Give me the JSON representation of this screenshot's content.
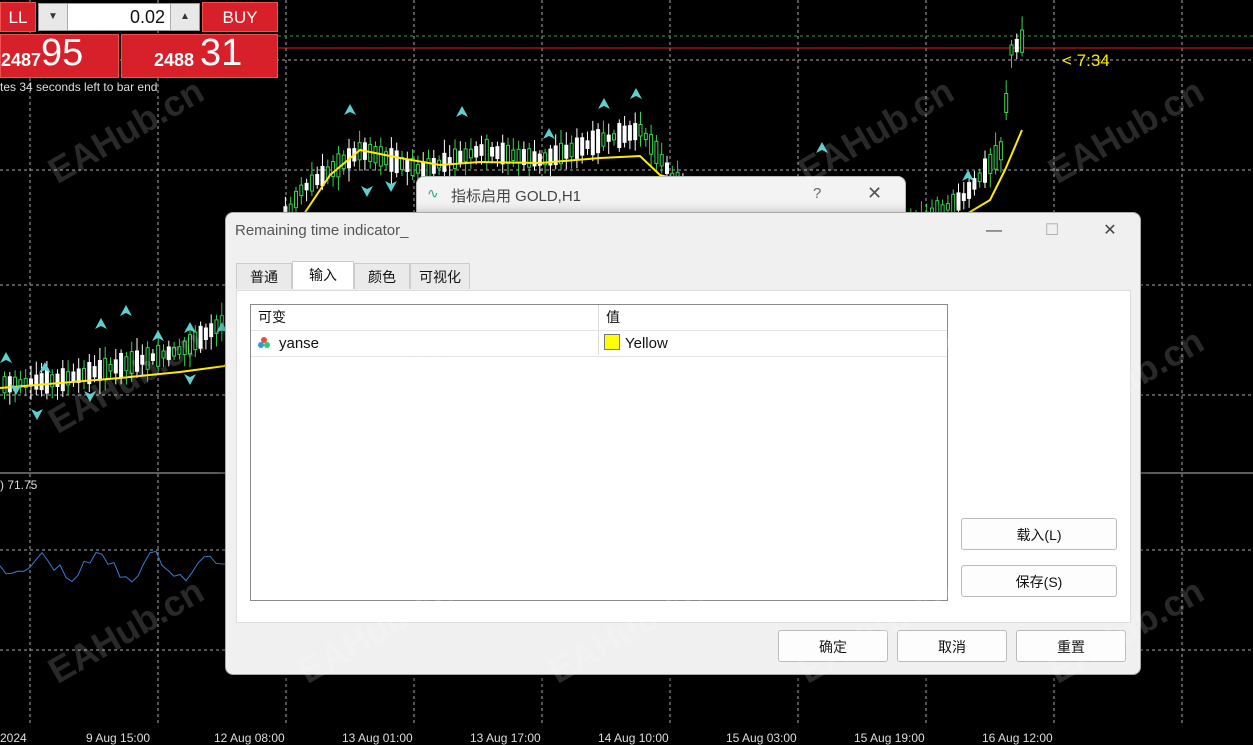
{
  "trade_panel": {
    "sell_label": "LL",
    "buy_label": "BUY",
    "lot_value": "0.02",
    "lot_down_glyph": "▼",
    "lot_up_glyph": "▲",
    "sell_price_small": "2487",
    "sell_price_big": "95",
    "buy_price_small": "2488",
    "buy_price_big": "31"
  },
  "countdown_text": "tes 34 seconds left to bar end",
  "remaining_time_label": "< 7:34",
  "oscillator_label": ") 71.75",
  "time_axis": [
    "2024",
    "9 Aug 15:00",
    "12 Aug 08:00",
    "13 Aug 01:00",
    "13 Aug 17:00",
    "14 Aug 10:00",
    "15 Aug 03:00",
    "15 Aug 19:00",
    "16 Aug 12:00"
  ],
  "watermark": "EAHub.cn",
  "back_dialog": {
    "title": "指标启用 GOLD,H1",
    "help": "?",
    "close": "✕"
  },
  "dialog": {
    "title": "Remaining time indicator_",
    "minimize": "—",
    "maximize": "☐",
    "close": "✕",
    "tabs": [
      {
        "label": "普通"
      },
      {
        "label": "输入"
      },
      {
        "label": "颜色"
      },
      {
        "label": "可视化"
      }
    ],
    "grid": {
      "col_variable": "可变",
      "col_value": "值",
      "rows": [
        {
          "name": "yanse",
          "value": "Yellow",
          "swatch_color": "#ffff00"
        }
      ]
    },
    "buttons": {
      "load": "载入(L)",
      "save": "保存(S)",
      "ok": "确定",
      "cancel": "取消",
      "reset": "重置"
    }
  },
  "colors": {
    "bull_candle": "#39d353",
    "bear_candle": "#ffffff",
    "ma_line": "#ffeb00",
    "oscillator": "#3a7bd5",
    "arrow": "#5fd0d0",
    "price_line": "#e02020",
    "trade_red": "#d8202a"
  }
}
